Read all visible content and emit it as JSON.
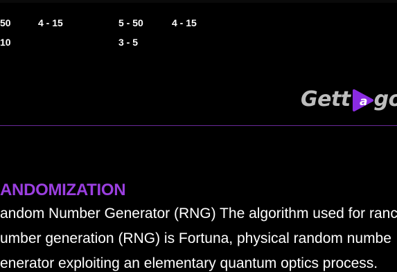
{
  "table": {
    "rows": [
      [
        "50",
        "4 - 15",
        "5 - 50",
        "4 - 15"
      ],
      [
        "10",
        "",
        "3 - 5",
        ""
      ]
    ]
  },
  "brand": {
    "logo_left": "Gett",
    "logo_right": "g",
    "logo_right_tail": "o",
    "accent": "#8a2be2",
    "logo_gray": "#bdbdbd"
  },
  "section": {
    "title": "ANDOMIZATION",
    "lines": [
      "andom Number Generator (RNG) The algorithm used for ranc",
      "umber generation (RNG) is Fortuna, physical random numbe",
      "enerator exploiting an elementary quantum optics process."
    ]
  },
  "colors": {
    "background": "#000000",
    "title": "#9b3fe0",
    "divider": "#6a2a9a",
    "text": "#ffffff"
  }
}
